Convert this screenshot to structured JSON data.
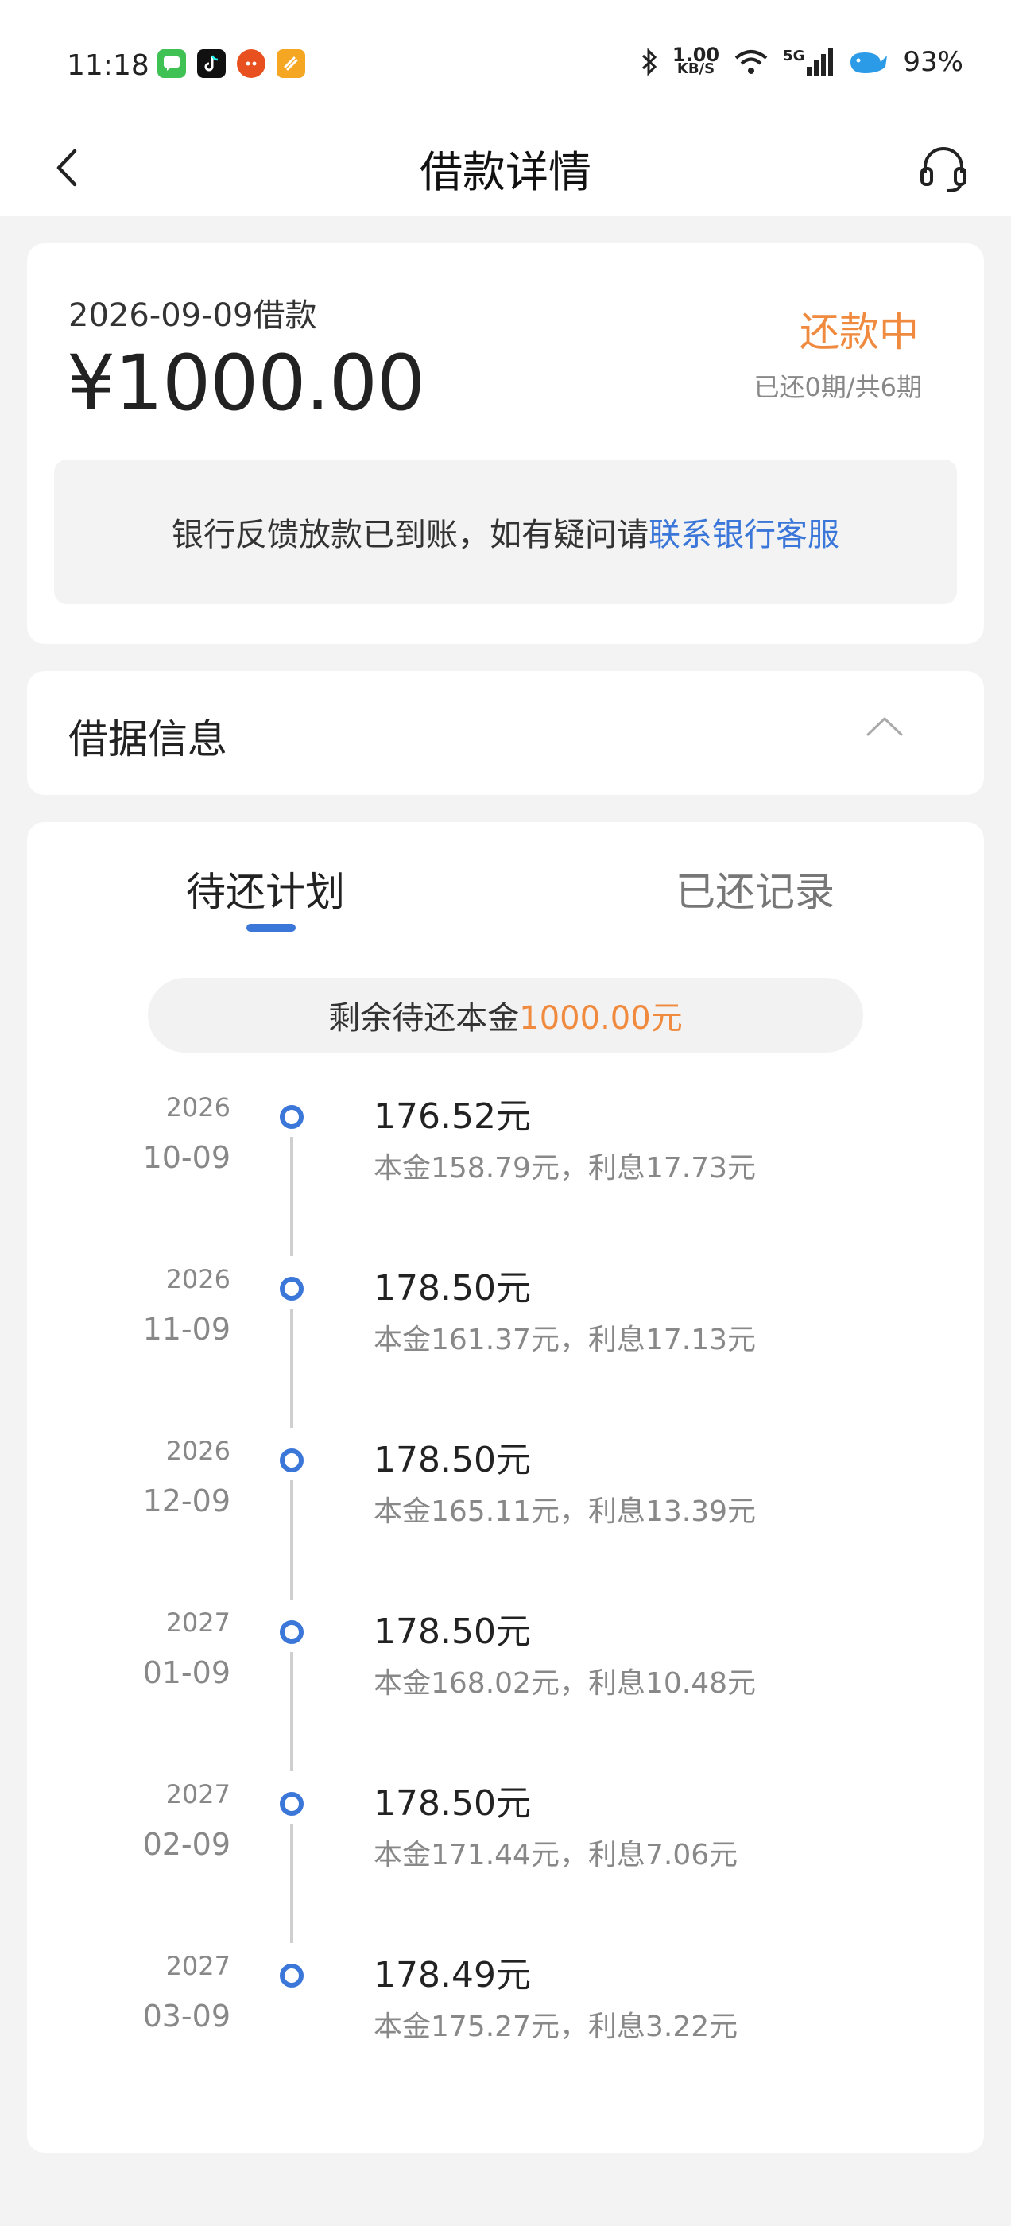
{
  "status_bar": {
    "time": "11:18",
    "net_speed_value": "1.00",
    "net_speed_unit": "KB/S",
    "network": "5G",
    "battery": "93%"
  },
  "nav": {
    "title": "借款详情"
  },
  "loan": {
    "date_label": "2026-09-09借款",
    "amount": "¥1000.00",
    "status": "还款中",
    "progress": "已还0期/共6期",
    "notice_text": "银行反馈放款已到账，如有疑问请",
    "notice_link": "联系银行客服"
  },
  "receipt": {
    "title": "借据信息"
  },
  "plan": {
    "tabs": [
      {
        "label": "待还计划"
      },
      {
        "label": "已还记录"
      }
    ],
    "remaining_label": "剩余待还本金",
    "remaining_amount": "1000.00元",
    "items": [
      {
        "year": "2026",
        "md": "10-09",
        "amount": "176.52元",
        "detail": "本金158.79元，利息17.73元"
      },
      {
        "year": "2026",
        "md": "11-09",
        "amount": "178.50元",
        "detail": "本金161.37元，利息17.13元"
      },
      {
        "year": "2026",
        "md": "12-09",
        "amount": "178.50元",
        "detail": "本金165.11元，利息13.39元"
      },
      {
        "year": "2027",
        "md": "01-09",
        "amount": "178.50元",
        "detail": "本金168.02元，利息10.48元"
      },
      {
        "year": "2027",
        "md": "02-09",
        "amount": "178.50元",
        "detail": "本金171.44元，利息7.06元"
      },
      {
        "year": "2027",
        "md": "03-09",
        "amount": "178.49元",
        "detail": "本金175.27元，利息3.22元"
      }
    ]
  },
  "colors": {
    "accent_blue": "#3b76d9",
    "accent_orange": "#ef8a3e"
  }
}
